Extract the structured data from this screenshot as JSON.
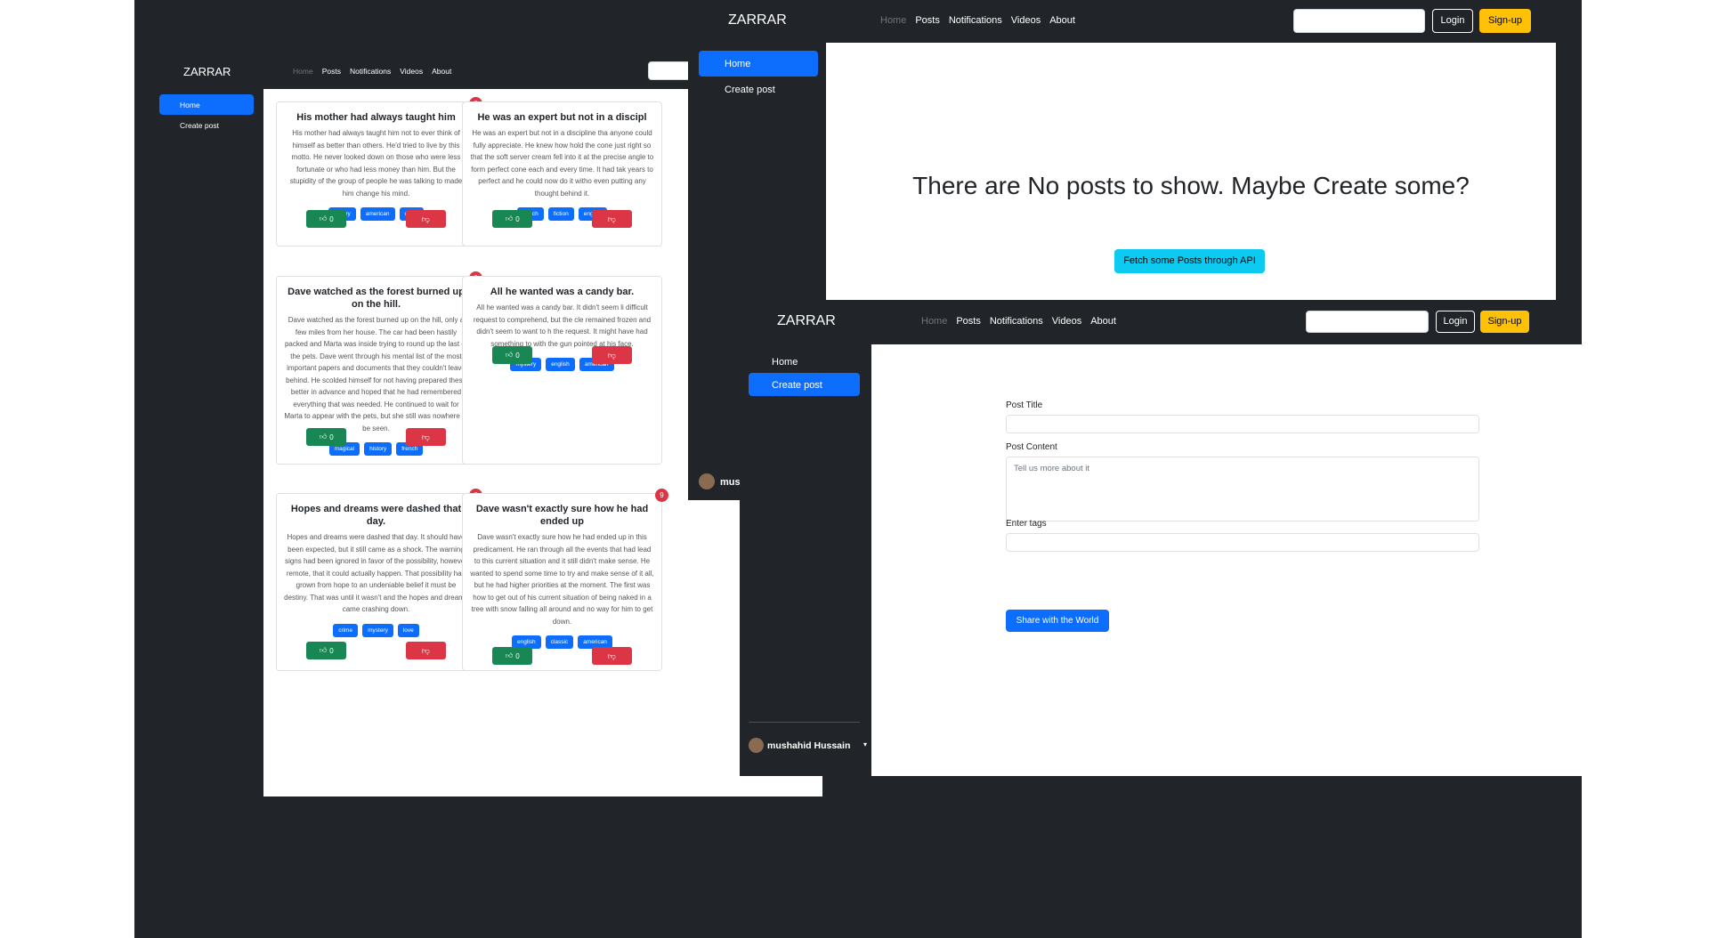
{
  "app": {
    "brand": "ZARRAR",
    "nav": [
      "Home",
      "Posts",
      "Notifications",
      "Videos",
      "About"
    ],
    "login_label": "Login",
    "signup_label": "Sign-up",
    "sidebar": [
      "Home",
      "Create post"
    ],
    "user_name": "mushahid Hussain",
    "user_name_cut": "mus"
  },
  "posts": [
    {
      "title": "His mother had always taught him",
      "body": "His mother had always taught him not to ever think of himself as better than others. He'd tried to live by this motto. He never looked down on those who were less fortunate or who had less money than him. But the stupidity of the group of people he was talking to made him change his mind.",
      "tags": [
        "history",
        "american",
        "crime"
      ],
      "badge": "6",
      "likes": "0"
    },
    {
      "title": "He was an expert but not in a discipl",
      "body": "He was an expert but not in a discipline tha anyone could fully appreciate. He knew how hold the cone just right so that the soft server cream fell into it at the precise angle to form perfect cone each and every time. It had tak years to perfect and he could now do it witho even putting any thought behind it.",
      "tags": [
        "french",
        "fiction",
        "english"
      ],
      "badge": "",
      "likes": "0"
    },
    {
      "title": "Dave watched as the forest burned up on the hill.",
      "body": "Dave watched as the forest burned up on the hill, only a few miles from her house. The car had been hastily packed and Marta was inside trying to round up the last of the pets. Dave went through his mental list of the most important papers and documents that they couldn't leave behind. He scolded himself for not having prepared these better in advance and hoped that he had remembered everything that was needed. He continued to wait for Marta to appear with the pets, but she still was nowhere to be seen.",
      "tags": [
        "magical",
        "history",
        "french"
      ],
      "badge": "6",
      "likes": "0"
    },
    {
      "title": "All he wanted was a candy bar.",
      "body": "All he wanted was a candy bar. It didn't seem li difficult request to comprehend, but the cle remained frozen and didn't seem to want to h the request. It might have had something to with the gun pointed at his face.",
      "tags": [
        "mystery",
        "english",
        "american"
      ],
      "badge": "",
      "likes": "0"
    },
    {
      "title": "Hopes and dreams were dashed that day.",
      "body": "Hopes and dreams were dashed that day. It should have been expected, but it still came as a shock. The warning signs had been ignored in favor of the possibility, however remote, that it could actually happen. That possibility had grown from hope to an undeniable belief it must be destiny. That was until it wasn't and the hopes and dreams came crashing down.",
      "tags": [
        "crime",
        "mystery",
        "love"
      ],
      "badge": "6",
      "likes": "0"
    },
    {
      "title": "Dave wasn't exactly sure how he had ended up",
      "body": "Dave wasn't exactly sure how he had ended up in this predicament. He ran through all the events that had lead to this current situation and it still didn't make sense. He wanted to spend some time to try and make sense of it all, but he had higher priorities at the moment. The first was how to get out of his current situation of being naked in a tree with snow falling all around and no way for him to get down.",
      "tags": [
        "english",
        "classic",
        "american"
      ],
      "badge": "9",
      "likes": "0"
    }
  ],
  "empty_state": {
    "heading": "There are No posts to show. Maybe Create some?",
    "fetch_button": "Fetch some Posts through API"
  },
  "create_form": {
    "title_label": "Post Title",
    "content_label": "Post Content",
    "content_placeholder": "Tell us more about it",
    "tags_label": "Enter tags",
    "submit_label": "Share with the World"
  },
  "colors": {
    "dark": "#212529",
    "primary": "#0d6efd",
    "success": "#198754",
    "danger": "#dc3545",
    "warning": "#ffc107",
    "info": "#0dcaf0"
  }
}
